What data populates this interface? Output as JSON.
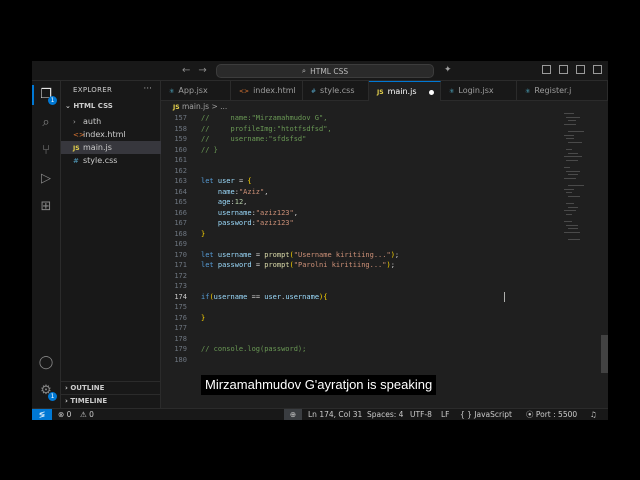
{
  "titlebar": {
    "back": "←",
    "forward": "→",
    "search_icon": "⌕",
    "search_text": "HTML CSS",
    "copilot": "✦"
  },
  "activity": {
    "explorer_badge": "1",
    "settings_badge": "1"
  },
  "sidebar": {
    "header": "EXPLORER",
    "more": "···",
    "project": "HTML CSS",
    "items": [
      {
        "label": "auth",
        "icon": "chevron-right-icon",
        "glyph": "›"
      },
      {
        "label": "index.html",
        "icon": "html-file-icon",
        "glyph": "<>"
      },
      {
        "label": "main.js",
        "icon": "js-file-icon",
        "glyph": "JS"
      },
      {
        "label": "style.css",
        "icon": "css-file-icon",
        "glyph": "#"
      }
    ],
    "outline": "OUTLINE",
    "timeline": "TIMELINE"
  },
  "tabs": [
    {
      "label": "App.jsx",
      "glyph": "⚛"
    },
    {
      "label": "index.html",
      "glyph": "<>"
    },
    {
      "label": "style.css",
      "glyph": "#"
    },
    {
      "label": "main.js",
      "glyph": "JS"
    },
    {
      "label": "Login.jsx",
      "glyph": "⚛"
    },
    {
      "label": "Register.j",
      "glyph": "⚛"
    }
  ],
  "breadcrumb": {
    "file": "main.js",
    "sep": ">",
    "rest": "..."
  },
  "code": {
    "lines": [
      {
        "n": "157",
        "text": "//     name:\"Mirzamahmudov G\","
      },
      {
        "n": "158",
        "text": "//     profileImg:\"htotfsdfsd\","
      },
      {
        "n": "159",
        "text": "//     username:\"sfdsfsd\""
      },
      {
        "n": "160",
        "text": "// }"
      },
      {
        "n": "161",
        "text": ""
      },
      {
        "n": "162",
        "text": ""
      },
      {
        "n": "163",
        "text": "let user = {"
      },
      {
        "n": "164",
        "text": "    name:\"Aziz\","
      },
      {
        "n": "165",
        "text": "    age:12,"
      },
      {
        "n": "166",
        "text": "    username:\"aziz123\","
      },
      {
        "n": "167",
        "text": "    password:\"aziz123\""
      },
      {
        "n": "168",
        "text": "}"
      },
      {
        "n": "169",
        "text": ""
      },
      {
        "n": "170",
        "text": "let username = prompt(\"Username kiritiing...\");"
      },
      {
        "n": "171",
        "text": "let password = prompt(\"Parolni kiritiing...\");"
      },
      {
        "n": "172",
        "text": ""
      },
      {
        "n": "173",
        "text": ""
      },
      {
        "n": "174",
        "text": "if(username == user.username){"
      },
      {
        "n": "175",
        "text": ""
      },
      {
        "n": "176",
        "text": "}"
      },
      {
        "n": "177",
        "text": ""
      },
      {
        "n": "178",
        "text": ""
      },
      {
        "n": "179",
        "text": "// console.log(password);"
      },
      {
        "n": "180",
        "text": ""
      }
    ],
    "current_line": "174"
  },
  "status": {
    "errors": "⊗ 0",
    "warnings": "⚠ 0",
    "zoom": "⊕",
    "position": "Ln 174, Col 31",
    "spaces": "Spaces: 4",
    "encoding": "UTF-8",
    "eol": "LF",
    "language": "{ } JavaScript",
    "port": "⦿ Port : 5500",
    "bell": "♫"
  },
  "caption": "Mirzamahmudov G'ayratjon is speaking",
  "colors": {
    "accent": "#0078d4",
    "editor_bg": "#1f1f1f",
    "chrome_bg": "#181818"
  }
}
